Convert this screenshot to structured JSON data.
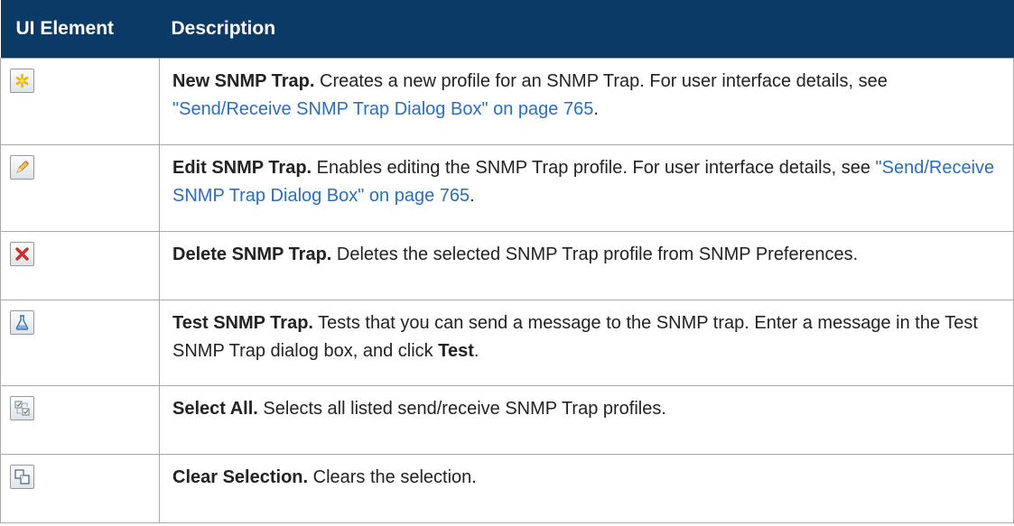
{
  "header": {
    "col_element": "UI Element",
    "col_description": "Description"
  },
  "rows": [
    {
      "icon": "new-snmp-trap-icon",
      "title": "New SNMP Trap.",
      "text": " Creates a new profile for an SNMP Trap. For user interface details, see ",
      "link": "\"Send/Receive SNMP Trap Dialog Box\" on page 765",
      "tail": "."
    },
    {
      "icon": "edit-pencil-icon",
      "title": "Edit SNMP Trap.",
      "text": " Enables editing the SNMP Trap profile. For user interface details, see ",
      "link": "\"Send/Receive SNMP Trap Dialog Box\" on page 765",
      "tail": "."
    },
    {
      "icon": "delete-x-icon",
      "title": "Delete SNMP Trap.",
      "text": " Deletes the selected SNMP Trap profile from SNMP Preferences."
    },
    {
      "icon": "test-flask-icon",
      "title": "Test SNMP Trap.",
      "text": " Tests that you can send a message to the SNMP trap. Enter a message in the Test SNMP Trap dialog box, and click ",
      "bold_word": "Test",
      "tail": "."
    },
    {
      "icon": "select-all-icon",
      "title": "Select All.",
      "text": " Selects all listed send/receive SNMP Trap profiles."
    },
    {
      "icon": "clear-selection-icon",
      "title": "Clear Selection.",
      "text": " Clears the selection."
    }
  ],
  "colors": {
    "header_bg": "#0b3a66",
    "link": "#2a6ebd",
    "border": "#a9a9a9"
  }
}
